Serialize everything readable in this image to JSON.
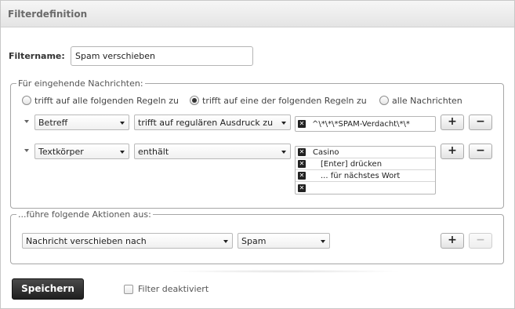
{
  "header": {
    "title": "Filterdefinition"
  },
  "filter_name": {
    "label": "Filtername:",
    "value": "Spam verschieben"
  },
  "incoming": {
    "legend": "Für eingehende Nachrichten:",
    "radios": [
      {
        "label": "trifft auf alle folgenden Regeln zu",
        "checked": false
      },
      {
        "label": "trifft auf eine der folgenden Regeln zu",
        "checked": true
      },
      {
        "label": "alle Nachrichten",
        "checked": false
      }
    ],
    "rules": [
      {
        "field": "Betreff",
        "operator": "trifft auf regulären Ausdruck zu",
        "value": "^\\*\\*\\*SPAM-Verdacht\\*\\*"
      },
      {
        "field": "Textkörper",
        "operator": "enthält",
        "list": [
          "Casino",
          "[Enter] drücken",
          "... für nächstes Wort",
          ""
        ]
      }
    ]
  },
  "actions": {
    "legend": "...führe folgende Aktionen aus:",
    "action": "Nachricht verschieben nach",
    "folder": "Spam"
  },
  "buttons": {
    "add": "+",
    "remove": "−",
    "save": "Speichern"
  },
  "disable_filter": {
    "label": "Filter deaktiviert",
    "checked": false
  },
  "icons": {
    "rule_toggle": "triangle-down-icon",
    "dropdown": "chevron-down-icon",
    "delete_entry": "delete-box-icon"
  }
}
